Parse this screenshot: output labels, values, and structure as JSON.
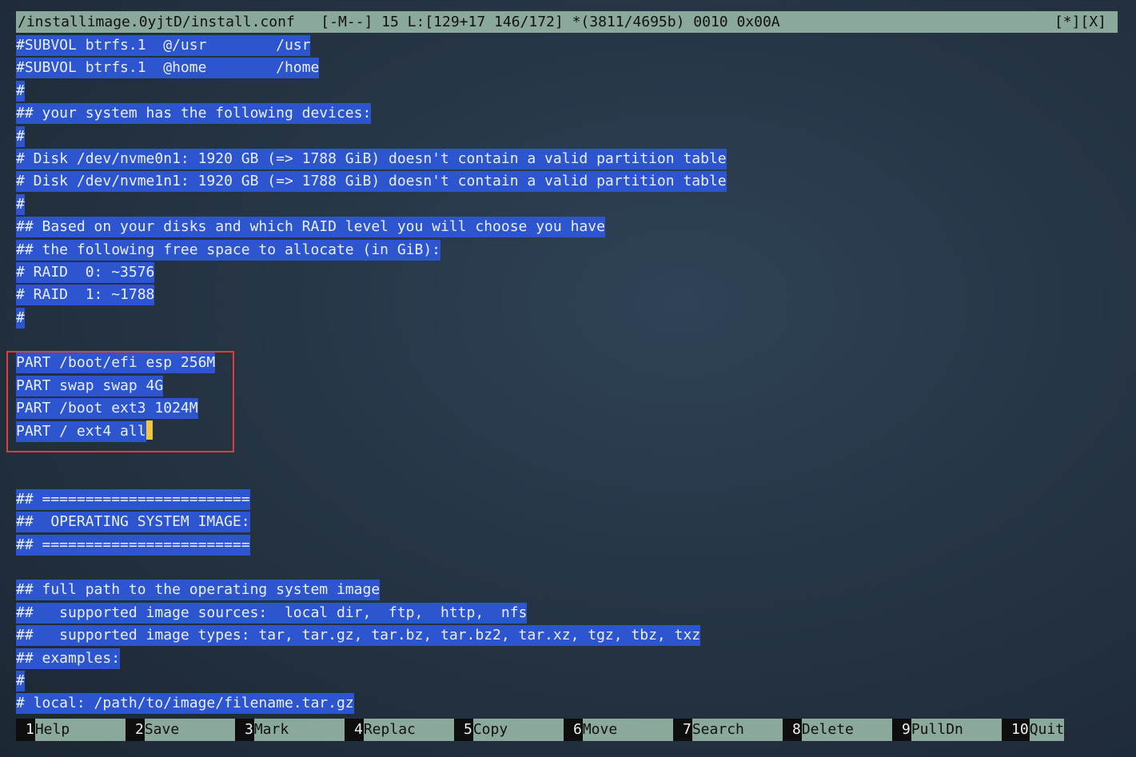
{
  "status": {
    "filename": "/installimage.0yjtD/install.conf",
    "info": "   [-M--] 15 L:[129+17 146/172] *(3811/4695b) 0010 0x00A",
    "controls": "[*][X]"
  },
  "lines": [
    "#SUBVOL btrfs.1  @/usr        /usr",
    "#SUBVOL btrfs.1  @home        /home",
    "#",
    "## your system has the following devices:",
    "#",
    "# Disk /dev/nvme0n1: 1920 GB (=> 1788 GiB) doesn't contain a valid partition table",
    "# Disk /dev/nvme1n1: 1920 GB (=> 1788 GiB) doesn't contain a valid partition table",
    "#",
    "## Based on your disks and which RAID level you will choose you have",
    "## the following free space to allocate (in GiB):",
    "# RAID  0: ~3576",
    "# RAID  1: ~1788",
    "#",
    "",
    "PART /boot/efi esp 256M",
    "PART swap swap 4G",
    "PART /boot ext3 1024M",
    "PART / ext4 all",
    "",
    "",
    "## ========================",
    "##  OPERATING SYSTEM IMAGE:",
    "## ========================",
    "",
    "## full path to the operating system image",
    "##   supported image sources:  local dir,  ftp,  http,  nfs",
    "##   supported image types: tar, tar.gz, tar.bz, tar.bz2, tar.xz, tgz, tbz, txz",
    "## examples:",
    "#",
    "# local: /path/to/image/filename.tar.gz"
  ],
  "cursor_line_index": 17,
  "fkeys": [
    {
      "num": "1",
      "label": "Help"
    },
    {
      "num": "2",
      "label": "Save"
    },
    {
      "num": "3",
      "label": "Mark"
    },
    {
      "num": "4",
      "label": "Replac"
    },
    {
      "num": "5",
      "label": "Copy"
    },
    {
      "num": "6",
      "label": "Move"
    },
    {
      "num": "7",
      "label": "Search"
    },
    {
      "num": "8",
      "label": "Delete"
    },
    {
      "num": "9",
      "label": "PullDn"
    },
    {
      "num": "10",
      "label": "Quit"
    }
  ],
  "colors": {
    "selection_bg": "#2c55cf",
    "status_bg": "#8aa99a",
    "cursor": "#f0c63c",
    "highlight_border": "#e23b3b"
  }
}
